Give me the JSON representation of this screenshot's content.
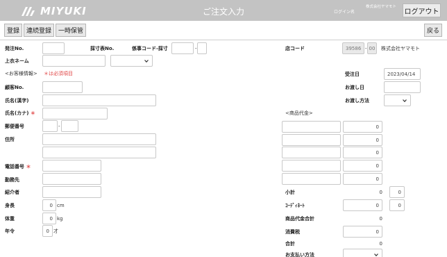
{
  "header": {
    "brand": "MIYUKI",
    "title": "ご注文入力",
    "login_label": "ログイン名",
    "company": "株式会社ヤマモト",
    "logout_label": "ログアウト"
  },
  "toolbar": {
    "register": "登録",
    "continuous_register": "連続登録",
    "temp_save": "一時保管",
    "back": "戻る"
  },
  "top_row": {
    "order_no_label": "発注No.",
    "sunpo_no_label": "採寸表No.",
    "staff_code_label": "係事コード-採寸",
    "store_code_label": "店コード",
    "store_code": "39586",
    "store_branch": "00",
    "store_name": "株式会社ヤマモト",
    "outer_name_label": "上衣ネーム"
  },
  "customer": {
    "section_label": "<お客様情報>",
    "required_note": "＊は必須項目",
    "customer_no": "顧客No.",
    "name_kanji": "氏名(漢字)",
    "name_kana": "氏名(カナ)",
    "postal": "郵便番号",
    "address": "住所",
    "phone": "電話番号",
    "workplace": "勤務先",
    "referrer": "紹介者",
    "height": "身長",
    "height_value": "0",
    "height_unit": "cm",
    "weight": "体重",
    "weight_value": "0",
    "weight_unit": "kg",
    "age": "年令",
    "age_value": "0",
    "age_unit": "才"
  },
  "order_info": {
    "order_date_label": "受注日",
    "order_date": "2023/04/14",
    "delivery_date_label": "お渡し日",
    "delivery_method_label": "お渡し方法"
  },
  "price": {
    "section_label": "<商品代金>",
    "row_values": [
      "0",
      "0",
      "0",
      "0",
      "0",
      "0"
    ],
    "subtotal_label": "小計",
    "subtotal": "0",
    "subtotal_qty": "0",
    "coordinate_label": "ｺｰﾃﾞｨﾈｰﾄ",
    "coordinate": "0",
    "coordinate_qty": "0",
    "goods_total_label": "商品代金合計",
    "goods_total": "0",
    "tax_label": "消費税",
    "tax": "0",
    "total_label": "合計",
    "total": "0",
    "payment_label": "お支払い方法"
  }
}
